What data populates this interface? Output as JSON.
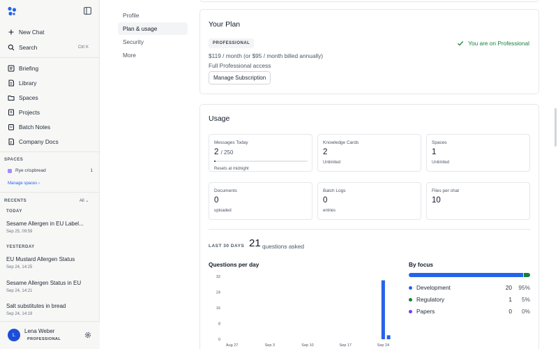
{
  "sidebar": {
    "top": [
      {
        "label": "New Chat",
        "icon": "plus-icon"
      },
      {
        "label": "Search",
        "icon": "search-icon",
        "shortcut": "Ctrl K"
      }
    ],
    "items": [
      {
        "label": "Briefing",
        "icon": "briefing-icon"
      },
      {
        "label": "Library",
        "icon": "library-icon"
      },
      {
        "label": "Spaces",
        "icon": "folder-icon"
      },
      {
        "label": "Projects",
        "icon": "projects-icon"
      },
      {
        "label": "Batch Notes",
        "icon": "batch-notes-icon"
      },
      {
        "label": "Company Docs",
        "icon": "company-docs-icon"
      }
    ],
    "spaces_label": "SPACES",
    "spaces": [
      {
        "name": "Rye crispbread",
        "count": "1",
        "color": "#a78bfa"
      }
    ],
    "manage_spaces": "Manage spaces",
    "recents_label": "RECENTS",
    "recents_filter": "All",
    "groups": [
      {
        "label": "TODAY",
        "items": [
          {
            "title": "Sesame Allergen in EU Label...",
            "time": "Sep 25, 09:59"
          }
        ]
      },
      {
        "label": "YESTERDAY",
        "items": [
          {
            "title": "EU Mustard Allergen Status",
            "time": "Sep 24, 14:25"
          },
          {
            "title": "Sesame Allergen Status in EU",
            "time": "Sep 24, 14:21"
          },
          {
            "title": "Salt substitutes in bread",
            "time": "Sep 24, 14:19"
          }
        ]
      }
    ],
    "user": {
      "initial": "L",
      "name": "Lena Weber",
      "plan": "PROFESSIONAL"
    }
  },
  "settings_nav": [
    {
      "label": "Profile",
      "active": false
    },
    {
      "label": "Plan & usage",
      "active": true
    },
    {
      "label": "Security",
      "active": false
    },
    {
      "label": "More",
      "active": false
    }
  ],
  "plan": {
    "title": "Your Plan",
    "badge": "PROFESSIONAL",
    "price": "$119 / month (or $95 / month billed annually)",
    "access": "Full Professional access",
    "manage_label": "Manage Subscription",
    "status": "You are on Professional",
    "status_color": "#15803d"
  },
  "usage": {
    "title": "Usage",
    "stats": [
      {
        "label": "Messages Today",
        "value": "2",
        "of": "/ 250",
        "sub": "Resets at midnight",
        "progress": 0.008
      },
      {
        "label": "Knowledge Cards",
        "value": "2",
        "sub": "Unlimited"
      },
      {
        "label": "Spaces",
        "value": "1",
        "sub": "Unlimited"
      },
      {
        "label": "Documents",
        "value": "0",
        "sub": "uploaded"
      },
      {
        "label": "Batch Logs",
        "value": "0",
        "sub": "entries"
      },
      {
        "label": "Files per chat",
        "value": "10",
        "sub": ""
      }
    ],
    "last30_label": "LAST 30 DAYS",
    "last30_count": "21",
    "last30_text": "questions asked",
    "chart_title": "Questions per day",
    "focus_title": "By focus",
    "focus": [
      {
        "label": "Development",
        "count": "20",
        "pct": "95%",
        "share": 0.95,
        "color": "#2563eb"
      },
      {
        "label": "Regulatory",
        "count": "1",
        "pct": "5%",
        "share": 0.05,
        "color": "#15803d"
      },
      {
        "label": "Papers",
        "count": "0",
        "pct": "0%",
        "share": 0,
        "color": "#7c3aed"
      }
    ]
  },
  "chart_data": {
    "type": "bar",
    "title": "Questions per day",
    "xlabel": "",
    "ylabel": "",
    "ylim": [
      0,
      32
    ],
    "yticks": [
      "0",
      "8",
      "16",
      "24",
      "32"
    ],
    "xticks": [
      "Aug 27",
      "Sep 3",
      "Sep 10",
      "Sep 17",
      "Sep 24"
    ],
    "categories": [
      "Aug 26",
      "Aug 27",
      "Aug 28",
      "Aug 29",
      "Aug 30",
      "Aug 31",
      "Sep 1",
      "Sep 2",
      "Sep 3",
      "Sep 4",
      "Sep 5",
      "Sep 6",
      "Sep 7",
      "Sep 8",
      "Sep 9",
      "Sep 10",
      "Sep 11",
      "Sep 12",
      "Sep 13",
      "Sep 14",
      "Sep 15",
      "Sep 16",
      "Sep 17",
      "Sep 18",
      "Sep 19",
      "Sep 20",
      "Sep 21",
      "Sep 22",
      "Sep 23",
      "Sep 24",
      "Sep 25"
    ],
    "values": [
      0,
      0,
      0,
      0,
      0,
      0,
      0,
      0,
      0,
      0,
      0,
      0,
      0,
      0,
      0,
      0,
      0,
      0,
      0,
      0,
      0,
      0,
      0,
      0,
      0,
      0,
      0,
      0,
      0,
      30,
      2
    ],
    "color": "#2563eb",
    "grid": false
  }
}
